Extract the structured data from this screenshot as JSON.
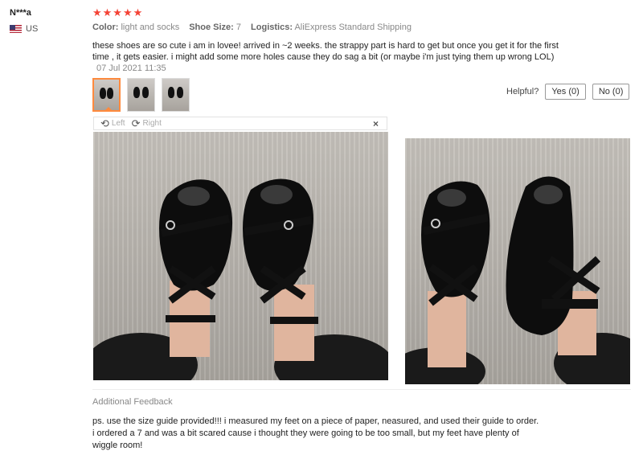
{
  "reviewer": {
    "name": "N***a",
    "country": "US"
  },
  "review": {
    "stars": "★★★★★",
    "rating": 5,
    "color_label": "Color:",
    "color_value": "light and socks",
    "size_label": "Shoe Size:",
    "size_value": "7",
    "logistics_label": "Logistics:",
    "logistics_value": "AliExpress Standard Shipping",
    "text": "these shoes are so cute i am in lovee! arrived in ~2 weeks. the strappy part is hard to get but once you get it for the first time , it gets easier. i might add some more holes cause they do sag a bit (or maybe i'm just tying them up wrong LOL)",
    "date": "07 Jul 2021 11:35"
  },
  "helpful": {
    "label": "Helpful?",
    "yes": "Yes (0)",
    "no": "No (0)"
  },
  "viewer": {
    "rotate_left": "Left",
    "rotate_right": "Right",
    "close": "×"
  },
  "additional": {
    "title": "Additional Feedback",
    "text": "ps. use the size guide provided!!! i measured my feet on a piece of paper, neasured, and used their guide to order. i ordered a 7 and was a bit scared cause i thought they were going to be too small, but my feet have plenty of wiggle room!"
  },
  "colors": {
    "star": "#f44336",
    "thumb_active_border": "#ff8a3d"
  },
  "icons": {
    "rotate_left": "rotate-left-icon",
    "rotate_right": "rotate-right-icon",
    "close": "close-icon",
    "flag": "us-flag-icon"
  }
}
